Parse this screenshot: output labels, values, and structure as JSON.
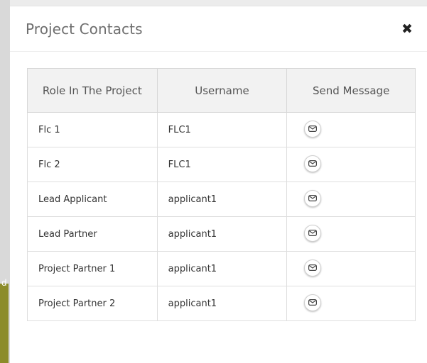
{
  "modal": {
    "title": "Project Contacts",
    "close_symbol": "✖"
  },
  "background": {
    "edge_glyph": "d"
  },
  "table": {
    "headers": [
      "Role In The Project",
      "Username",
      "Send Message"
    ],
    "rows": [
      {
        "role": "Flc 1",
        "username": "FLC1"
      },
      {
        "role": "Flc 2",
        "username": "FLC1"
      },
      {
        "role": "Lead Applicant",
        "username": "applicant1"
      },
      {
        "role": "Lead Partner",
        "username": "applicant1"
      },
      {
        "role": "Project Partner 1",
        "username": "applicant1"
      },
      {
        "role": "Project Partner 2",
        "username": "applicant1"
      }
    ],
    "action_icon": "envelope-icon"
  }
}
